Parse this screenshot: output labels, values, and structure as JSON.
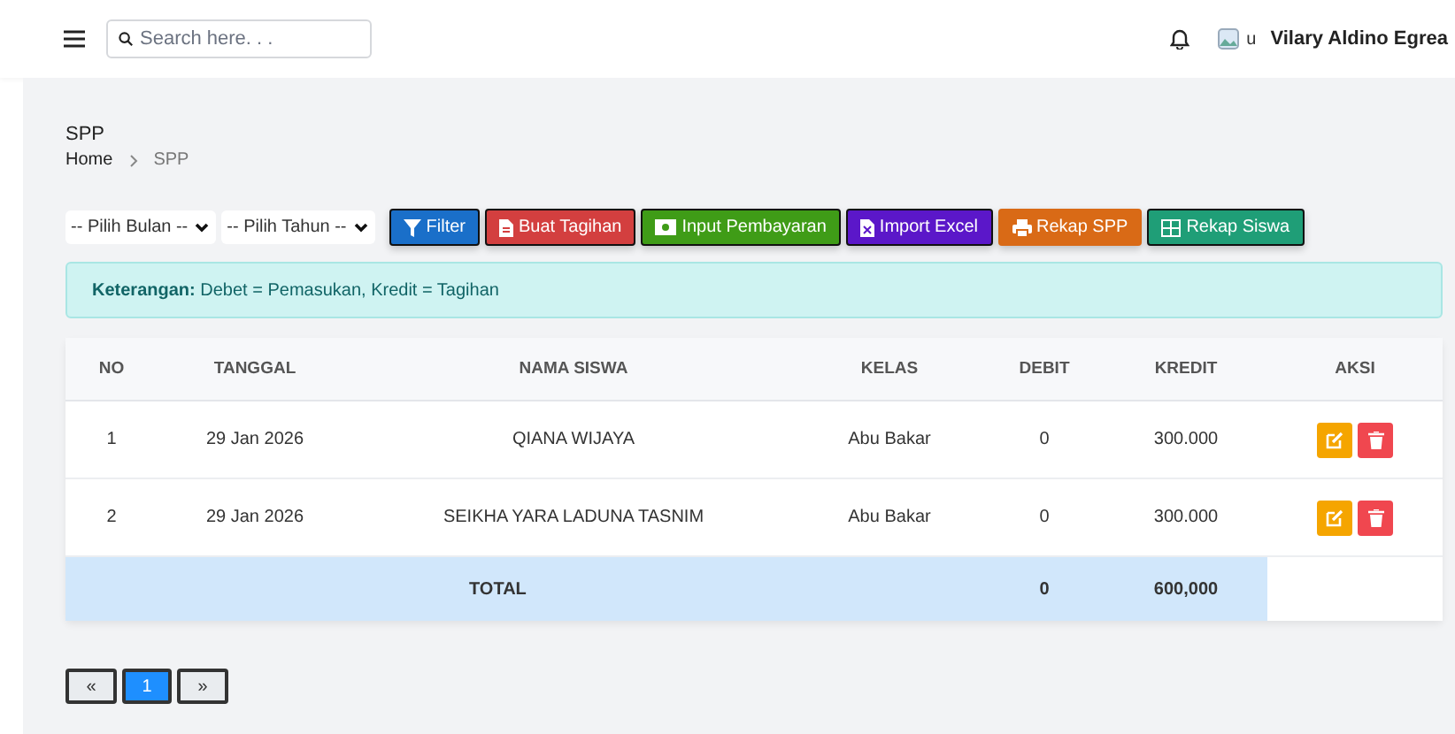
{
  "header": {
    "search": {
      "placeholder": "Search here. . ."
    },
    "avatar_alt": "u",
    "user_name": "Vilary Aldino Egrea"
  },
  "page": {
    "title": "SPP",
    "breadcrumb": [
      {
        "label": "Home"
      },
      {
        "label": "SPP"
      }
    ]
  },
  "filters": [
    {
      "value": "-- Pilih Bulan --"
    },
    {
      "value": "-- Pilih Tahun --"
    }
  ],
  "buttons": [
    {
      "label": "Filter",
      "kind": "filter",
      "color": "#1a6fc9"
    },
    {
      "label": "Buat Tagihan",
      "kind": "file",
      "color": "#d33f3f"
    },
    {
      "label": "Input Pembayaran",
      "kind": "money",
      "color": "#3f9c17"
    },
    {
      "label": "Import Excel",
      "kind": "excel",
      "color": "#5b17c9"
    },
    {
      "label": "Rekap SPP",
      "kind": "print",
      "color": "#d96a16"
    },
    {
      "label": "Rekap Siswa",
      "kind": "table",
      "color": "#1f9e77"
    }
  ],
  "note": "**Keterangan:** Debet = Pemasukan, Kredit = Tagihan",
  "table": {
    "columns": [
      "NO",
      "TANGGAL",
      "NAMA SISWA",
      "KELAS",
      "DEBIT",
      "KREDIT",
      "AKSI"
    ],
    "rows": [
      [
        "1",
        "29 Jan 2026",
        "QIANA WIJAYA",
        "Abu Bakar",
        "0",
        "300.000"
      ],
      [
        "2",
        "29 Jan 2026",
        "SEIKHA YARA LADUNA TASNIM",
        "Abu Bakar",
        "0",
        "300.000"
      ]
    ],
    "total": {
      "label": "TOTAL",
      "debit": "0",
      "kredit": "600,000"
    }
  },
  "pagination": [
    {
      "label": "«",
      "selected": false
    },
    {
      "label": "1",
      "selected": true
    },
    {
      "label": "»",
      "selected": false
    }
  ]
}
